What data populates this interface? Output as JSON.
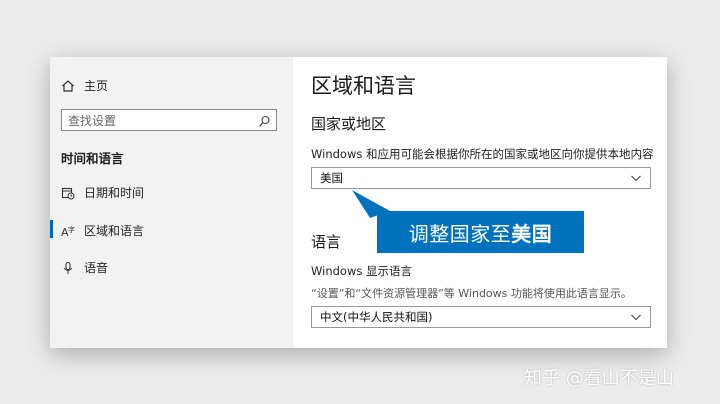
{
  "sidebar": {
    "home_label": "主页",
    "search_placeholder": "查找设置",
    "section_title": "时间和语言",
    "items": [
      {
        "label": "日期和时间",
        "icon": "calendar-clock-icon"
      },
      {
        "label": "区域和语言",
        "icon": "language-icon",
        "active": true
      },
      {
        "label": "语音",
        "icon": "microphone-icon"
      }
    ]
  },
  "main": {
    "title": "区域和语言",
    "region": {
      "heading": "国家或地区",
      "description": "Windows 和应用可能会根据你所在的国家或地区向你提供本地内容",
      "selected": "美国"
    },
    "language": {
      "heading": "语言",
      "display_label": "Windows 显示语言",
      "display_description": "“设置”和“文件资源管理器”等 Windows 功能将使用此语言显示。",
      "selected": "中文(中华人民共和国)"
    }
  },
  "callout": {
    "prefix": "调整国家至",
    "emphasis": "美国"
  },
  "watermark": "知乎 @看山不是山",
  "colors": {
    "accent": "#0067c0",
    "callout": "#0071bd",
    "sidebar_bg": "#f2f2f2"
  }
}
